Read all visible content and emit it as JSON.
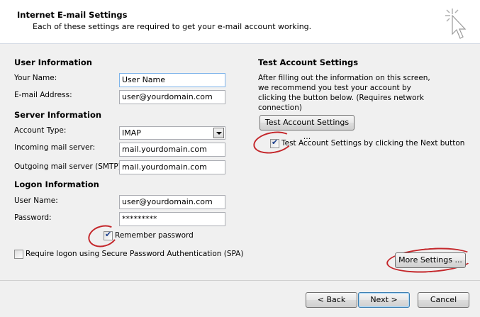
{
  "header": {
    "title": "Internet E-mail Settings",
    "subtitle": "Each of these settings are required to get your e-mail account working."
  },
  "user_info": {
    "heading": "User Information",
    "name_label": "Your Name:",
    "name_value": "User Name",
    "email_label": "E-mail Address:",
    "email_value": "user@yourdomain.com"
  },
  "server_info": {
    "heading": "Server Information",
    "account_type_label": "Account Type:",
    "account_type_value": "IMAP",
    "incoming_label": "Incoming mail server:",
    "incoming_value": "mail.yourdomain.com",
    "outgoing_label": "Outgoing mail server (SMTP):",
    "outgoing_value": "mail.yourdomain.com"
  },
  "logon_info": {
    "heading": "Logon Information",
    "username_label": "User Name:",
    "username_value": "user@yourdomain.com",
    "password_label": "Password:",
    "password_value": "*********",
    "remember_label": "Remember password",
    "remember_checked": true,
    "spa_label": "Require logon using Secure Password Authentication (SPA)",
    "spa_checked": false
  },
  "test_settings": {
    "heading": "Test Account Settings",
    "description": "After filling out the information on this screen, we recommend you test your account by clicking the button below. (Requires network connection)",
    "test_button_label": "Test Account Settings ...",
    "next_test_label": "Test Account Settings by clicking the Next button",
    "next_test_checked": true,
    "more_settings_label": "More Settings ..."
  },
  "footer": {
    "back_label": "< Back",
    "next_label": "Next >",
    "cancel_label": "Cancel"
  },
  "colors": {
    "highlight_circle": "#c4262a",
    "background": "#f0f0f0"
  },
  "icons": {
    "header_icon": "cursor-click-icon"
  }
}
